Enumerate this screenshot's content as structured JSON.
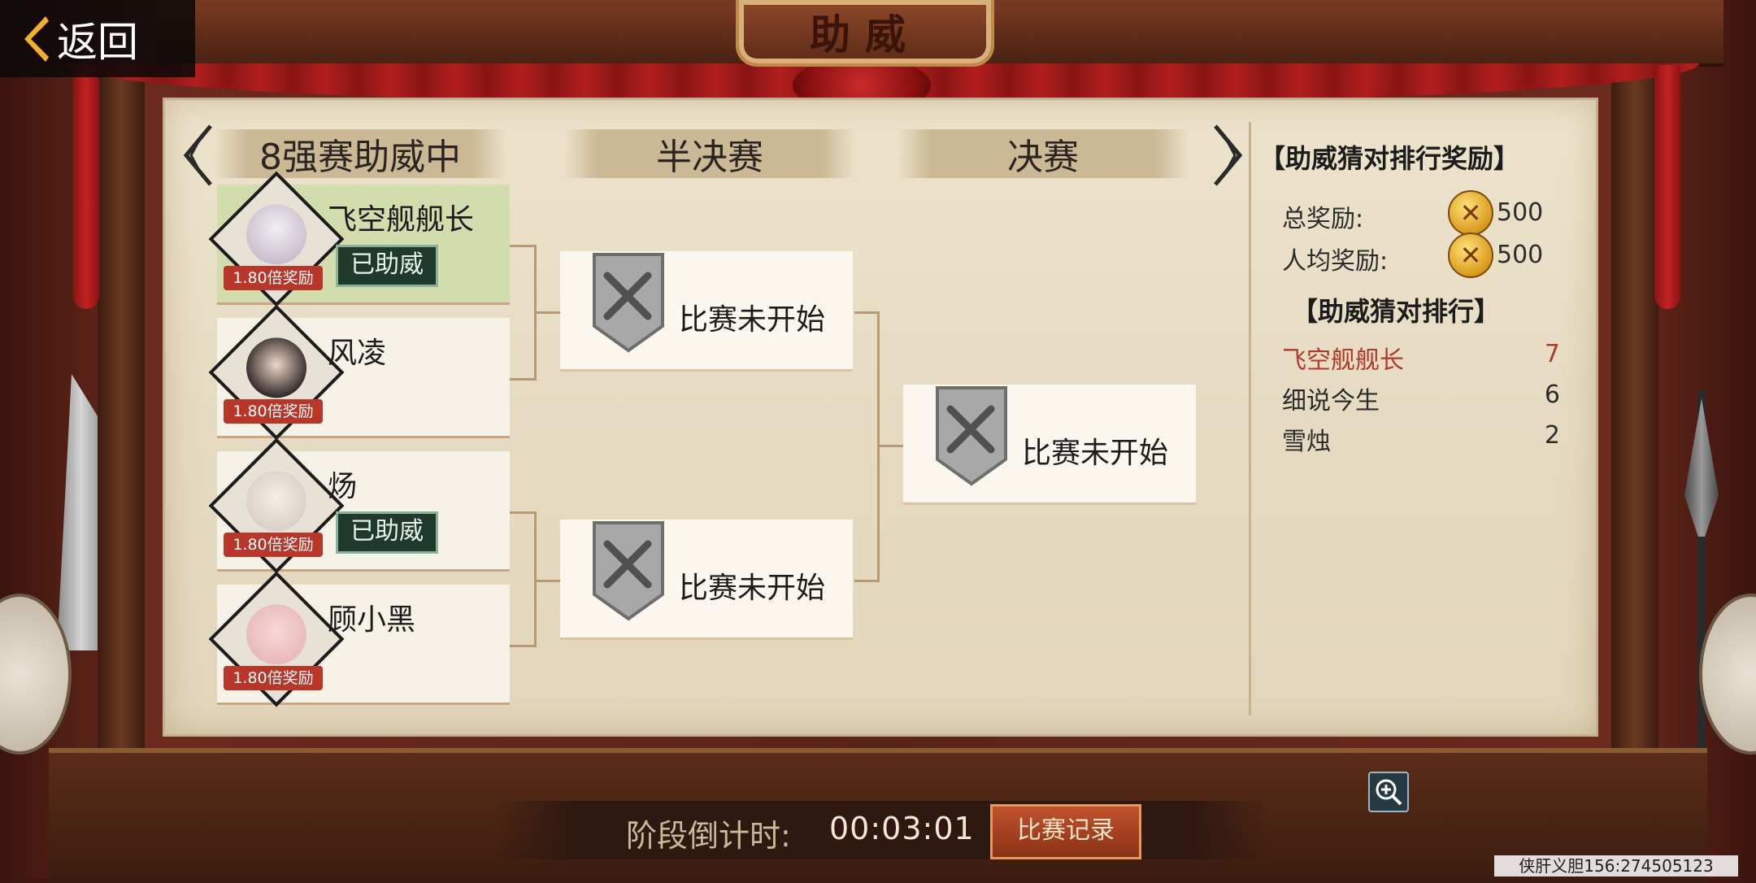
{
  "header": {
    "title": "助威",
    "back_label": "返回"
  },
  "rounds": [
    {
      "label": "8强赛助威中"
    },
    {
      "label": "半决赛"
    },
    {
      "label": "决赛"
    }
  ],
  "players": [
    {
      "name": "飞空舰舰长",
      "multiplier": "1.80倍奖励",
      "cheered": true,
      "cheered_label": "已助威"
    },
    {
      "name": "风凌",
      "multiplier": "1.80倍奖励",
      "cheered": false
    },
    {
      "name": "炀",
      "multiplier": "1.80倍奖励",
      "cheered": true,
      "cheered_label": "已助威"
    },
    {
      "name": "顾小黑",
      "multiplier": "1.80倍奖励",
      "cheered": false
    }
  ],
  "matches": {
    "semi_1": "比赛未开始",
    "semi_2": "比赛未开始",
    "final": "比赛未开始"
  },
  "panel": {
    "reward_title": "【助威猜对排行奖励】",
    "total_label": "总奖励:",
    "total_value": "500",
    "per_label": "人均奖励:",
    "per_value": "500",
    "rank_title": "【助威猜对排行】",
    "ranking": [
      {
        "name": "飞空舰舰长",
        "count": "7"
      },
      {
        "name": "细说今生",
        "count": "6"
      },
      {
        "name": "雪烛",
        "count": "2"
      }
    ]
  },
  "footer": {
    "countdown_label": "阶段倒计时:",
    "countdown_value": "00:03:01",
    "record_button": "比赛记录"
  },
  "watermark": "侠肝义胆156:274505123",
  "colors": {
    "cheered_card": "#d3dcac",
    "top_rank": "#b03a2a",
    "multiplier_badge": "#b8362a",
    "coin": "#d99a1c"
  }
}
